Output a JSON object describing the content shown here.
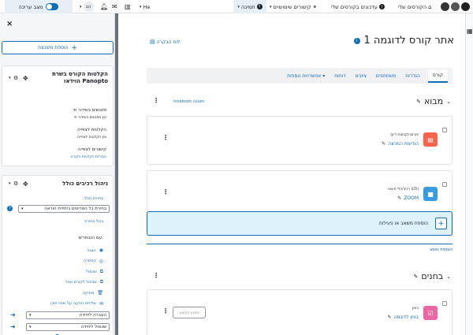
{
  "topbar": {
    "brand_label": "הקורסים שלי",
    "nav_items": [
      "עדכונים בקורסים שלי",
      "קישורים שימושיים",
      "תמיכה"
    ],
    "lang": "He",
    "user_initials": "הב",
    "edit_mode_label": "מצב עריכה"
  },
  "drawer": {
    "close_label": "×",
    "add_block_label": "הוספת משבצת",
    "panopto": {
      "title": "הקלטות הקורס בשרת הוידאו Panopto",
      "live_title": "מפגשים בשידור חי",
      "live_empty": "אין מפגשים בשידור חי",
      "recordings_title": "הקלטות לצפייה",
      "recordings_empty": "אין הקלטות לצפייה",
      "links_title": "קישורים לצפייה",
      "links_link": "הגדרות הקלטות הקורס"
    },
    "bulk": {
      "title": "ניהול רכיבים כולל",
      "select_all": "בחירת הכל",
      "select_value": "בחירת כל הפריטים ביחידת הוראה",
      "cancel_select": "בטל בחירה",
      "with_selected": "עם הנבחרים:",
      "actions": [
        "הצגה",
        "הסתרה",
        "שכפול",
        "שכפול לקורס אחר",
        "מחיקה",
        "שליחת הודעה על שינוי תוכן"
      ],
      "move_label": "העברה ליחידה",
      "copy_label": "שכפול ליחידה"
    }
  },
  "main": {
    "gradebook_link": "לוח הבקרה",
    "course_title": "אתר קורס לדוגמה 1",
    "tabs": [
      "קורס",
      "הגדרות",
      "משתתפים",
      "ציונים",
      "דוחות",
      "אפשרויות נוספות"
    ],
    "sections": [
      {
        "title": "מבוא",
        "preview_link": "תצוגה מצומצמת",
        "activities": [
          {
            "type": "פורום (קבוצת דיון)",
            "name": "הודעות המרצה"
          },
          {
            "type": "רכיב/כלי חיצוני (LTI)",
            "name": "ZOOM"
          }
        ],
        "add_label": "הוספת משאב או פעילות",
        "add_topic_link": "הוספת נושא"
      },
      {
        "title": "בחנים",
        "activities": [
          {
            "type": "בוחן",
            "name": "בוחן לדוגמה",
            "mark_done": "סימון כבוצע"
          }
        ]
      }
    ]
  },
  "colors": {
    "accent": "#0f6cbf",
    "forum": "#f7634d",
    "lti": "#399be2",
    "quiz": "#eb66a2"
  }
}
